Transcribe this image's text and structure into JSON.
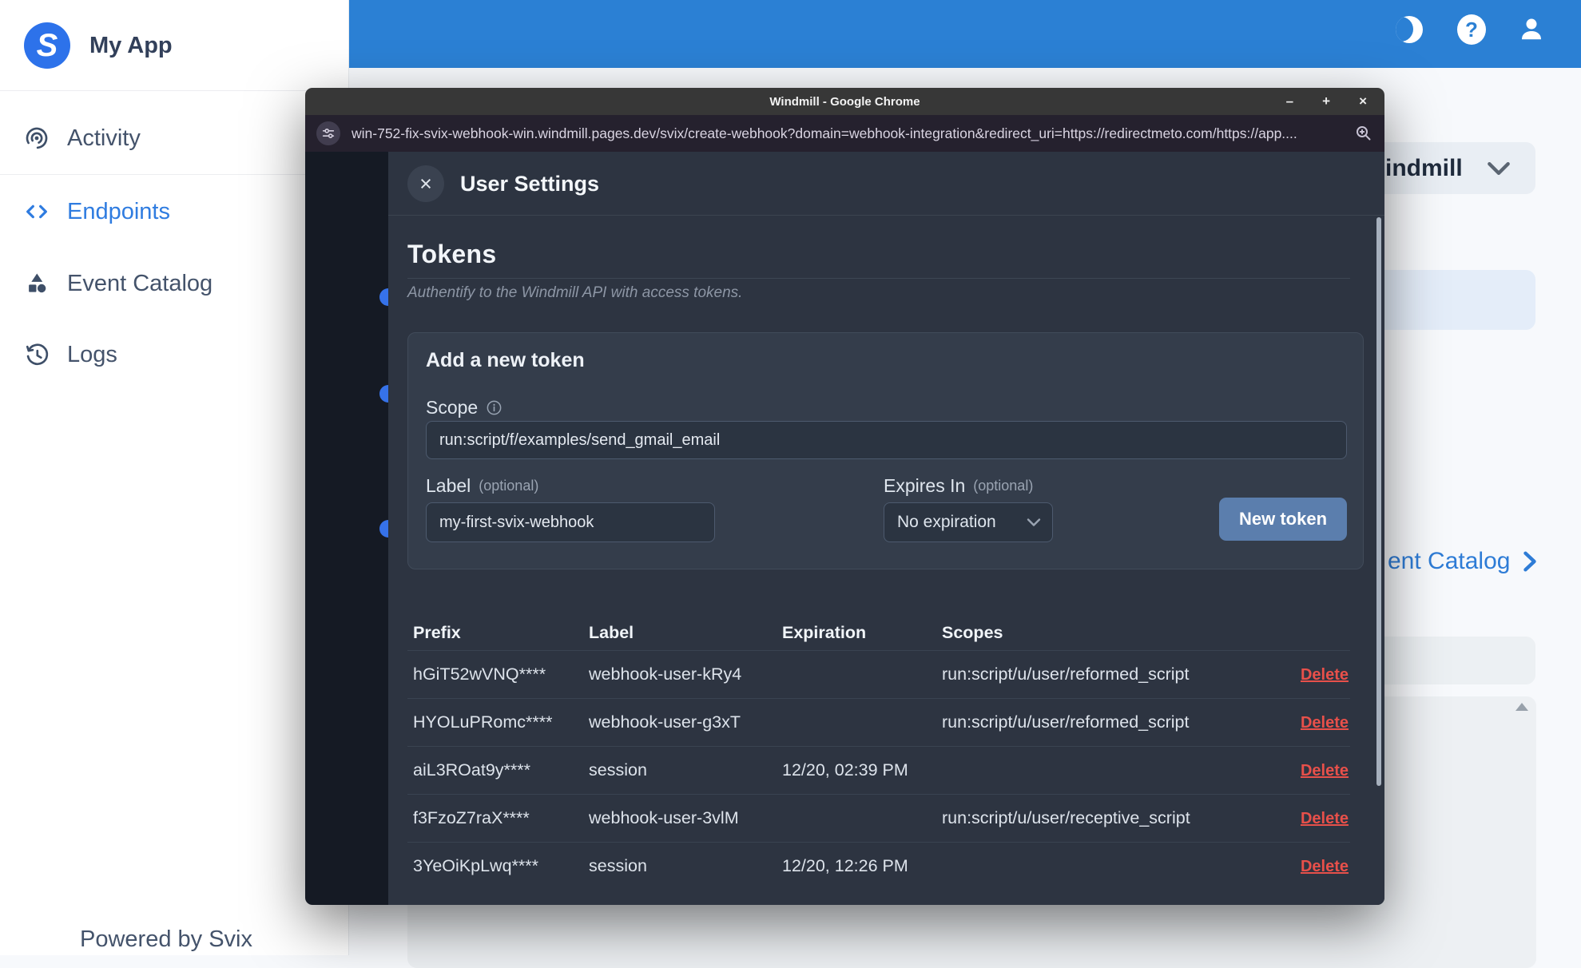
{
  "colors": {
    "topbar_blue": "#2b80d4",
    "accent_blue": "#2f7ce0",
    "delete_red": "#e8504a",
    "button_blue": "#5b7ead",
    "modal_bg": "#2d3441"
  },
  "sidebar": {
    "logo_letter": "S",
    "app_title": "My App",
    "items": [
      {
        "label": "Activity"
      },
      {
        "label": "Endpoints"
      },
      {
        "label": "Event Catalog"
      },
      {
        "label": "Logs"
      }
    ],
    "footer": "Powered by Svix"
  },
  "background_page": {
    "workspace_label": "indmill",
    "event_catalog_link": "ent Catalog"
  },
  "chrome": {
    "window_title": "Windmill - Google Chrome",
    "url": "win-752-fix-svix-webhook-win.windmill.pages.dev/svix/create-webhook?domain=webhook-integration&redirect_uri=https://redirectmeto.com/https://app....",
    "controls": {
      "minimize": "–",
      "maximize": "+",
      "close": "×"
    }
  },
  "modal": {
    "title": "User Settings",
    "close_label": "×",
    "section_title": "Tokens",
    "section_subtitle": "Authentify to the Windmill API with access tokens.",
    "card": {
      "title": "Add a new token",
      "scope_label": "Scope",
      "scope_value": "run:script/f/examples/send_gmail_email",
      "label_label": "Label",
      "optional": "(optional)",
      "label_value": "my-first-svix-webhook",
      "expires_label": "Expires In",
      "expires_value": "No expiration",
      "button": "New token"
    },
    "table": {
      "headers": [
        "Prefix",
        "Label",
        "Expiration",
        "Scopes"
      ],
      "delete_label": "Delete",
      "rows": [
        {
          "prefix": "hGiT52wVNQ****",
          "label": "webhook-user-kRy4",
          "expiration": "",
          "scopes": "run:script/u/user/reformed_script"
        },
        {
          "prefix": "HYOLuPRomc****",
          "label": "webhook-user-g3xT",
          "expiration": "",
          "scopes": "run:script/u/user/reformed_script"
        },
        {
          "prefix": "aiL3ROat9y****",
          "label": "session",
          "expiration": "12/20, 02:39 PM",
          "scopes": ""
        },
        {
          "prefix": "f3FzoZ7raX****",
          "label": "webhook-user-3vlM",
          "expiration": "",
          "scopes": "run:script/u/user/receptive_script"
        },
        {
          "prefix": "3YeOiKpLwq****",
          "label": "session",
          "expiration": "12/20, 12:26 PM",
          "scopes": ""
        }
      ]
    }
  }
}
